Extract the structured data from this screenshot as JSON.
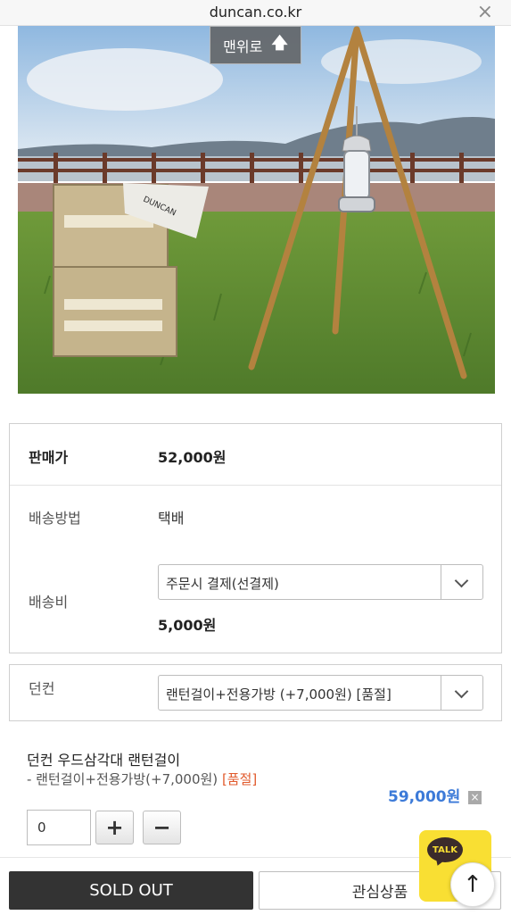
{
  "browser": {
    "domain": "duncan.co.kr",
    "close_symbol": "×"
  },
  "photo": {
    "brand_on_box": "DUNCAN",
    "back_to_top": "맨위로",
    "back_to_top_icon": "arrow-up-icon"
  },
  "info": {
    "price_label": "판매가",
    "price_value": "52,000원",
    "shipping_method_label": "배송방법",
    "shipping_method_value": "택배",
    "shipping_fee_label": "배송비",
    "shipping_fee_select": "주문시 결제(선결제)",
    "shipping_fee_value": "5,000원"
  },
  "option": {
    "label": "던컨",
    "select": "랜턴걸이+전용가방 (+7,000원) [품절]"
  },
  "selected_item": {
    "name": "던컨 우드삼각대 랜턴걸이",
    "option_prefix": "- 랜턴걸이+전용가방(+7,000원) ",
    "option_soldout": "[품절]",
    "price": "59,000원",
    "remove_symbol": "×",
    "quantity": "0",
    "plus": "+",
    "minus": "−"
  },
  "bottom": {
    "soldout": "SOLD OUT",
    "wishlist": "관심상품",
    "talk": "TALK",
    "scroll_top_symbol": "↑"
  },
  "colors": {
    "price_blue": "#3c7ad8",
    "soldout_orange": "#e15a2c",
    "talk_yellow": "#f9df33",
    "dark_button": "#333333"
  }
}
